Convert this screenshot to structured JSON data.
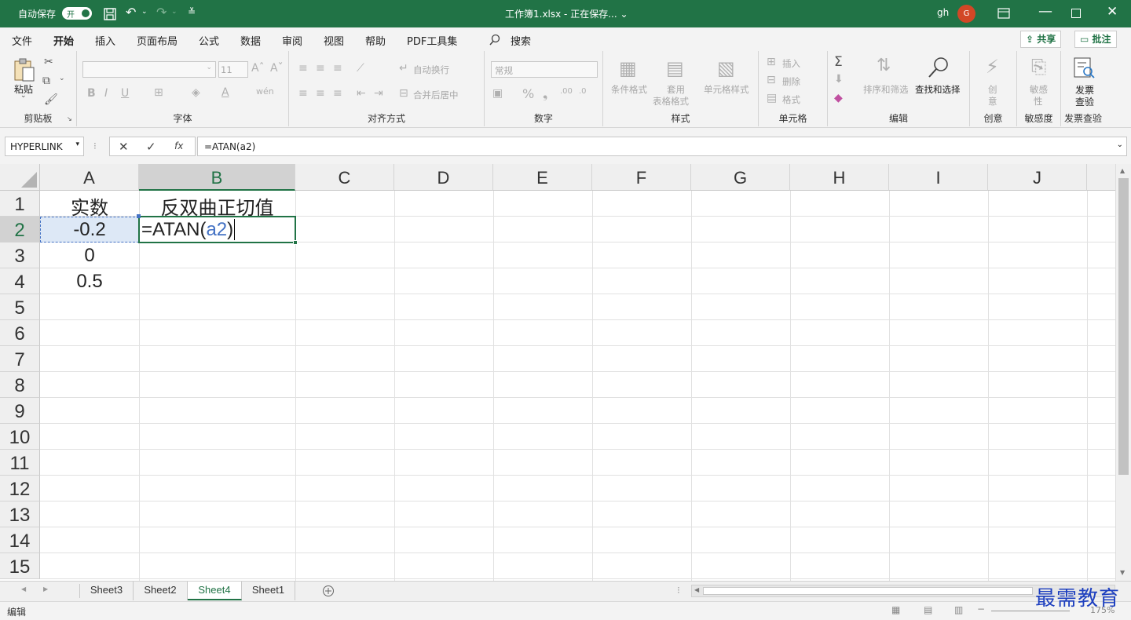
{
  "titlebar": {
    "autosave_label": "自动保存",
    "toggle_state": "开",
    "doc_title": "工作簿1.xlsx - 正在保存... ⌄",
    "user": "gh",
    "avatar_initial": "G"
  },
  "menu": {
    "tabs": [
      "文件",
      "开始",
      "插入",
      "页面布局",
      "公式",
      "数据",
      "审阅",
      "视图",
      "帮助",
      "PDF工具集"
    ],
    "search": "搜索",
    "share": "共享",
    "comment": "批注"
  },
  "ribbon": {
    "clipboard": {
      "paste": "粘贴",
      "label": "剪贴板"
    },
    "font": {
      "size": "11",
      "label": "字体",
      "bold": "B",
      "italic": "I",
      "underline": "U"
    },
    "align": {
      "wrap": "自动换行",
      "merge": "合并后居中",
      "label": "对齐方式"
    },
    "number": {
      "format": "常规",
      "label": "数字"
    },
    "styles": {
      "cond": "条件格式",
      "table1": "套用",
      "table2": "表格格式",
      "cell": "单元格样式",
      "label": "样式"
    },
    "cells": {
      "insert": "插入",
      "delete": "删除",
      "format": "格式",
      "label": "单元格"
    },
    "editing": {
      "sort": "排序和筛选",
      "find": "查找和选择",
      "label": "编辑"
    },
    "idea": {
      "btn1": "创",
      "btn2": "意",
      "label": "创意"
    },
    "sens": {
      "btn1": "敏感",
      "btn2": "性",
      "label": "敏感度"
    },
    "invoice": {
      "btn1": "发票",
      "btn2": "查验",
      "label": "发票查验"
    }
  },
  "formula_bar": {
    "name_box": "HYPERLINK",
    "fx": "fx",
    "formula": "=ATAN(a2)"
  },
  "grid": {
    "columns": [
      "A",
      "B",
      "C",
      "D",
      "E",
      "F",
      "G",
      "H",
      "I",
      "J"
    ],
    "rows": [
      "1",
      "2",
      "3",
      "4",
      "5",
      "6",
      "7",
      "8",
      "9",
      "10",
      "11",
      "12",
      "13",
      "14",
      "15"
    ],
    "A1": "实数",
    "B1": "反双曲正切值",
    "A2": "-0.2",
    "A3": "0",
    "A4": "0.5",
    "B2_prefix": "=ATAN(",
    "B2_ref": "a2",
    "B2_suffix": ")"
  },
  "sheets": {
    "tabs": [
      "Sheet3",
      "Sheet2",
      "Sheet4",
      "Sheet1"
    ],
    "active": "Sheet4"
  },
  "status": {
    "mode": "编辑",
    "zoom": "175%"
  },
  "watermark": "最需教育",
  "colors": {
    "accent": "#217346",
    "ref_blue": "#4472c4"
  }
}
